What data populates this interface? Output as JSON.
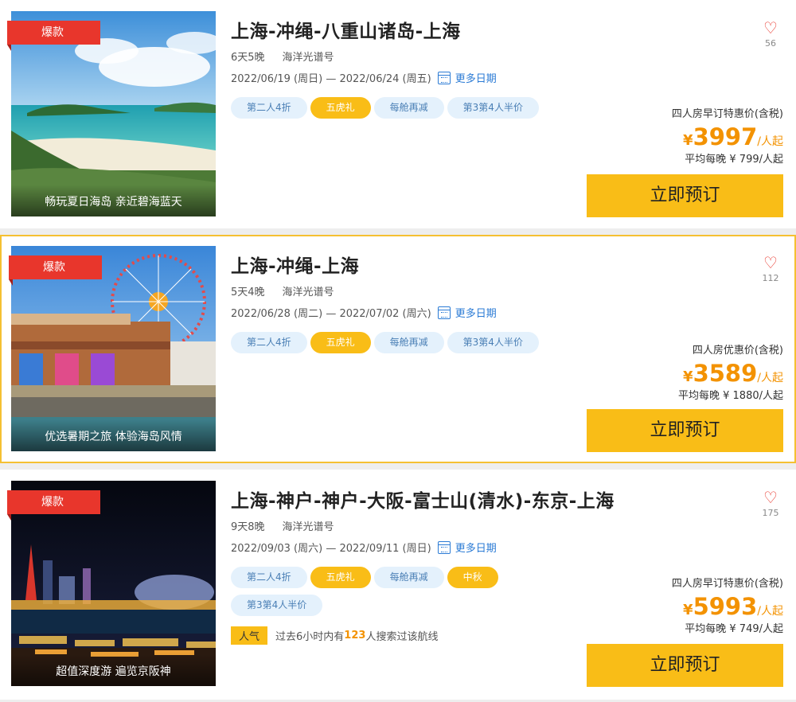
{
  "cards": [
    {
      "badge": "爆款",
      "caption": "畅玩夏日海岛 亲近碧海蓝天",
      "title": "上海-冲绳-八重山诸岛-上海",
      "duration": "6天5晚",
      "ship": "海洋光谱号",
      "dates": "2022/06/19 (周日) — 2022/06/24 (周五)",
      "more_dates": "更多日期",
      "tags": [
        "第二人4折",
        "五虎礼",
        "每舱再减",
        "第3第4人半价"
      ],
      "fav_count": "56",
      "price_label": "四人房早订特惠价(含税)",
      "currency": "¥",
      "price": "3997",
      "price_unit": "/人起",
      "avg": "平均每晚 ¥ 799/人起",
      "book": "立即预订"
    },
    {
      "badge": "爆款",
      "caption": "优选暑期之旅 体验海岛风情",
      "title": "上海-冲绳-上海",
      "duration": "5天4晚",
      "ship": "海洋光谱号",
      "dates": "2022/06/28 (周二) — 2022/07/02 (周六)",
      "more_dates": "更多日期",
      "tags": [
        "第二人4折",
        "五虎礼",
        "每舱再减",
        "第3第4人半价"
      ],
      "fav_count": "112",
      "price_label": "四人房优惠价(含税)",
      "currency": "¥",
      "price": "3589",
      "price_unit": "/人起",
      "avg": "平均每晚 ¥ 1880/人起",
      "book": "立即预订"
    },
    {
      "badge": "爆款",
      "caption": "超值深度游 遍览京阪神",
      "title": "上海-神户-神户-大阪-富士山(清水)-东京-上海",
      "duration": "9天8晚",
      "ship": "海洋光谱号",
      "dates": "2022/09/03 (周六) — 2022/09/11 (周日)",
      "more_dates": "更多日期",
      "tags": [
        "第二人4折",
        "五虎礼",
        "每舱再减",
        "中秋",
        "第3第4人半价"
      ],
      "popular_label": "人气",
      "popular_pre": "过去6小时内有",
      "popular_num": "123",
      "popular_post": "人搜索过该航线",
      "fav_count": "175",
      "price_label": "四人房早订特惠价(含税)",
      "currency": "¥",
      "price": "5993",
      "price_unit": "/人起",
      "avg": "平均每晚 ¥ 749/人起",
      "book": "立即预订"
    }
  ],
  "colors": {
    "accent_yellow": "#f9bd17",
    "price_orange": "#f39200",
    "badge_red": "#e8362c",
    "link_blue": "#2b7bd5",
    "tag_bg": "#e4f1fc"
  },
  "icons": [
    "heart-icon",
    "calendar-icon"
  ]
}
